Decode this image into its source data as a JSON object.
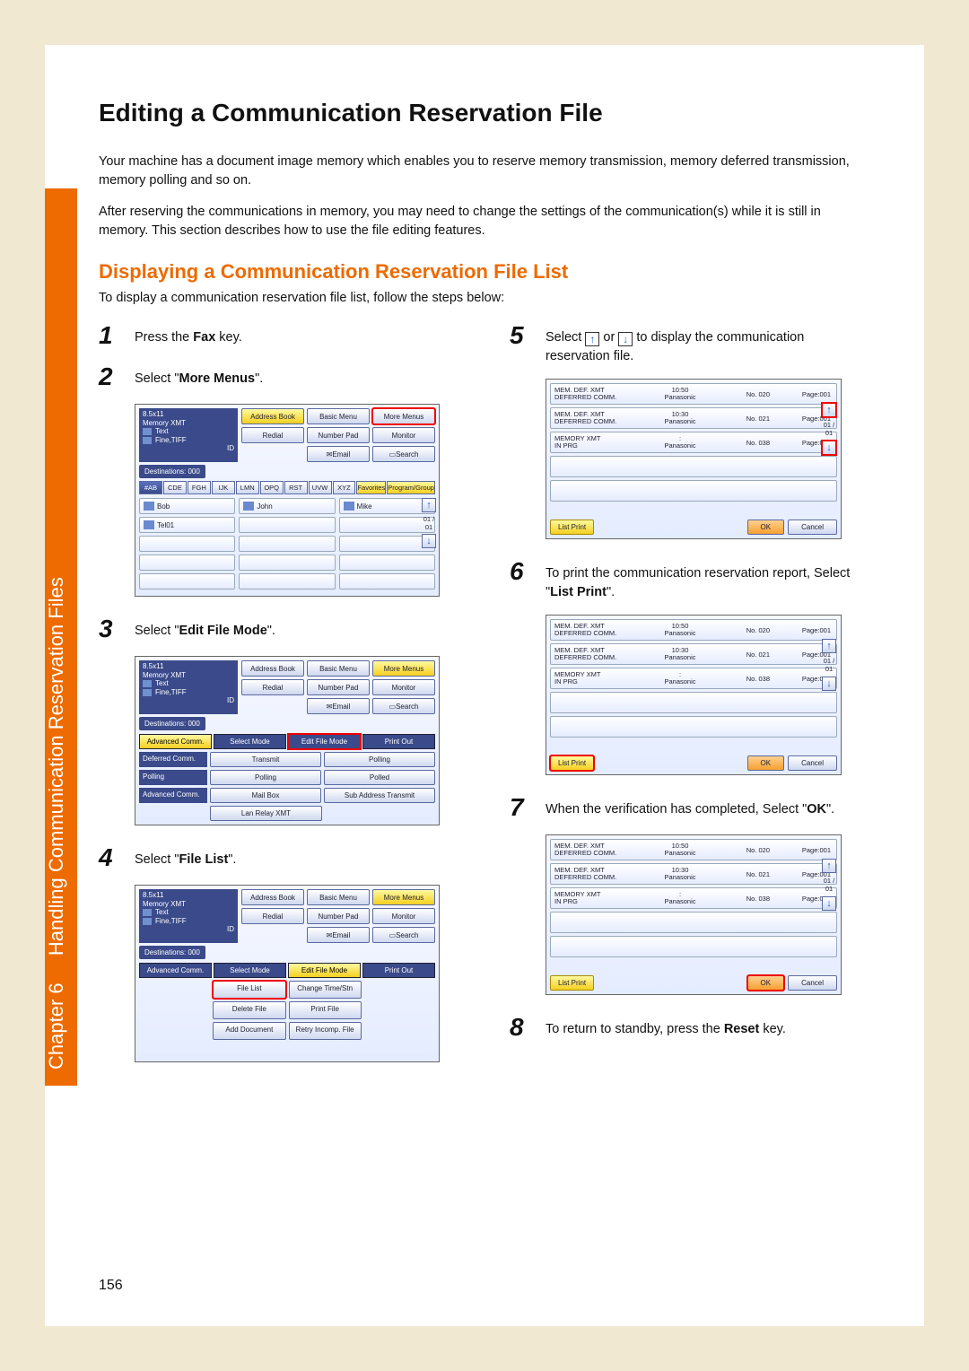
{
  "spine": {
    "chapter": "Chapter 6",
    "title": "Handling Communication Reservation Files"
  },
  "pageTitle": "Editing a Communication Reservation File",
  "intro": {
    "p1": "Your machine has a document image memory which enables you to reserve memory transmission, memory deferred transmission, memory polling and so on.",
    "p2": "After reserving the communications in memory, you may need to change the settings of the communication(s) while it is still in memory. This section describes how to use the file editing features."
  },
  "sectionTitle": "Displaying a Communication Reservation File List",
  "sectionIntro": "To display a communication reservation file list, follow the steps below:",
  "steps": {
    "s1": {
      "num": "1",
      "pre": "Press the ",
      "bold": "Fax",
      "post": " key."
    },
    "s2": {
      "num": "2",
      "pre": "Select \"",
      "bold": "More Menus",
      "post": "\"."
    },
    "s3": {
      "num": "3",
      "pre": "Select \"",
      "bold": "Edit File Mode",
      "post": "\"."
    },
    "s4": {
      "num": "4",
      "pre": "Select \"",
      "bold": "File List",
      "post": "\"."
    },
    "s5": {
      "num": "5",
      "text": "to display the communication reservation file.",
      "pre": "Select ",
      "mid": " or "
    },
    "s6": {
      "num": "6",
      "text_pre": "To print the communication reservation report, Select \"",
      "bold": "List Print",
      "post": "\"."
    },
    "s7": {
      "num": "7",
      "pre": "When the verification has completed, Select \"",
      "bold": "OK",
      "post": "\"."
    },
    "s8": {
      "num": "8",
      "pre": "To return to standby, press the ",
      "bold": "Reset",
      "post": " key."
    }
  },
  "panelCommon": {
    "docSize": "8.5x11",
    "memory": "Memory XMT",
    "icoText": "Text",
    "fine": "Fine,TIFF",
    "id": "ID",
    "addressBook": "Address Book",
    "basicMenu": "Basic Menu",
    "moreMenus": "More Menus",
    "redial": "Redial",
    "numberPad": "Number Pad",
    "monitor": "Monitor",
    "email": "Email",
    "search": "Search",
    "dest": "Destinations: 000"
  },
  "panel2": {
    "tabs": [
      "#AB",
      "CDE",
      "FGH",
      "IJK",
      "LMN",
      "OPQ",
      "RST",
      "UVW",
      "XYZ"
    ],
    "favorites": "Favorites",
    "program": "Program/Group",
    "names": [
      "Bob",
      "John",
      "Mike",
      "Tel01"
    ],
    "page": "01 / 01"
  },
  "panel3": {
    "modeTabs": {
      "adv": "Advanced Comm.",
      "sel": "Select Mode",
      "edit": "Edit File Mode",
      "print": "Print Out"
    },
    "rows": {
      "deferred": "Deferred Comm.",
      "transmit": "Transmit",
      "polling": "Polling",
      "pollingLbl": "Polling",
      "polling2": "Polling",
      "polled": "Polled",
      "advLbl": "Advanced Comm.",
      "mailbox": "Mail Box",
      "subaddr": "Sub Address Transmit",
      "lanRelay": "Lan Relay XMT"
    }
  },
  "panel4": {
    "rows": {
      "fileList": "File List",
      "changeTime": "Change Time/Stn",
      "deleteFile": "Delete File",
      "printFile": "Print File",
      "addDoc": "Add Document",
      "retry": "Retry Incomp. File"
    }
  },
  "listPanel": {
    "items": [
      {
        "l1a": "MEM. DEF. XMT",
        "l1b": "DEFERRED COMM.",
        "l2a": "10:50",
        "l2b": "Panasonic",
        "no": "No. 020",
        "pg": "Page:001"
      },
      {
        "l1a": "MEM. DEF. XMT",
        "l1b": "DEFERRED COMM.",
        "l2a": "10:30",
        "l2b": "Panasonic",
        "no": "No. 021",
        "pg": "Page:001"
      },
      {
        "l1a": "MEMORY XMT",
        "l1b": "IN PRG",
        "l2a": ":",
        "l2b": "Panasonic",
        "no": "No. 038",
        "pg": "Page:005"
      }
    ],
    "listPrint": "List Print",
    "ok": "OK",
    "cancel": "Cancel",
    "page": "01 / 01"
  },
  "pageNumber": "156"
}
